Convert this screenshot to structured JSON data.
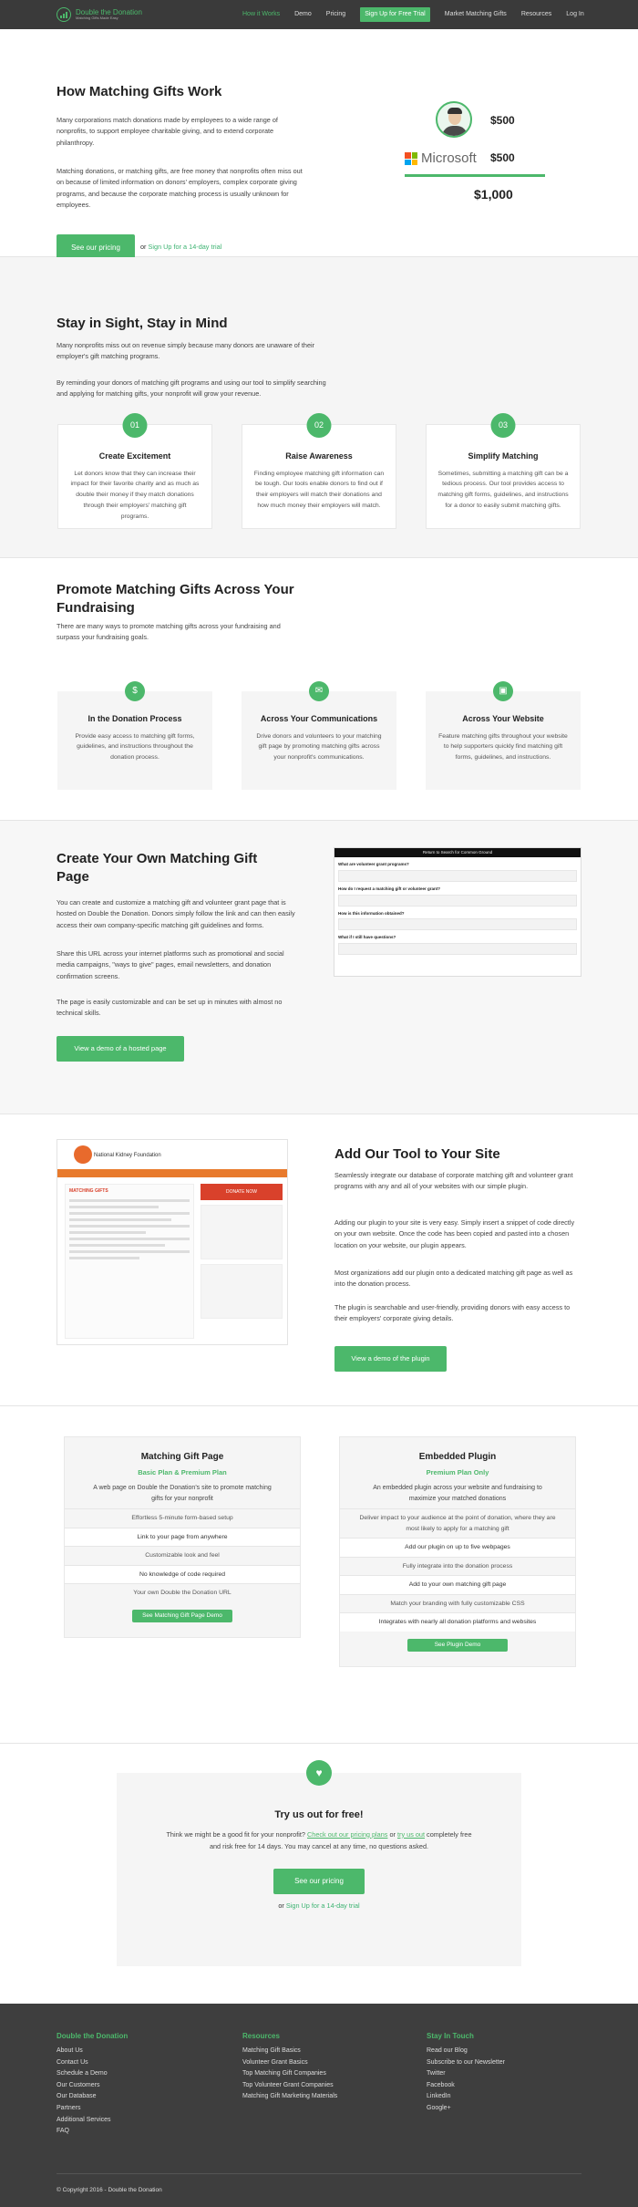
{
  "nav": {
    "logo_main": "Double the Donation",
    "logo_sub": "Matching Gifts Made Easy",
    "links": [
      "How it Works",
      "Demo",
      "Pricing"
    ],
    "cta": "Sign Up for Free Trial",
    "links2": [
      "Market Matching Gifts",
      "Resources",
      "Log In"
    ]
  },
  "hero": {
    "title": "How Matching Gifts Work",
    "p1": "Many corporations match donations made by employees to a wide range of nonprofits, to support employee charitable giving, and to extend corporate philanthropy.",
    "p2": "Matching donations, or matching gifts, are free money that nonprofits often miss out on because of limited information on donors' employers, complex corporate giving programs, and because the corporate matching process is usually unknown for employees.",
    "btn": "See our pricing",
    "or": "or",
    "trial": "Sign Up for a 14-day trial",
    "amt1": "$500",
    "company": "Microsoft",
    "amt2": "$500",
    "total": "$1,000"
  },
  "s2": {
    "title": "Stay in Sight, Stay in Mind",
    "p1": "Many nonprofits miss out on revenue simply because many donors are unaware of their employer's gift matching programs.",
    "p2": "By reminding your donors of matching gift programs and using our tool to simplify searching and applying for matching gifts, your nonprofit will grow your revenue.",
    "cards": [
      {
        "num": "01",
        "title": "Create Excitement",
        "desc": "Let donors know that they can increase their impact for their favorite charity and as much as double their money if they match donations through their employers' matching gift programs."
      },
      {
        "num": "02",
        "title": "Raise Awareness",
        "desc": "Finding employee matching gift information can be tough. Our tools enable donors to find out if their employers will match their donations and how much money their employers will match."
      },
      {
        "num": "03",
        "title": "Simplify Matching",
        "desc": "Sometimes, submitting a matching gift can be a tedious process. Our tool provides access to matching gift forms, guidelines, and instructions for a donor to easily submit matching gifts."
      }
    ]
  },
  "s3": {
    "title": "Promote Matching Gifts Across Your Fundraising",
    "p1": "There are many ways to promote matching gifts across your fundraising and surpass your fundraising goals.",
    "cards": [
      {
        "icon": "$",
        "title": "In the Donation Process",
        "desc": "Provide easy access to matching gift forms, guidelines, and instructions throughout the donation process."
      },
      {
        "icon": "✉",
        "title": "Across Your Communications",
        "desc": "Drive donors and volunteers to your matching gift page by promoting matching gifts across your nonprofit's communications."
      },
      {
        "icon": "▣",
        "title": "Across Your Website",
        "desc": "Feature matching gifts throughout your website to help supporters quickly find matching gift forms, guidelines, and instructions."
      }
    ]
  },
  "s4": {
    "title": "Create Your Own Matching Gift Page",
    "p1": "You can create and customize a matching gift and volunteer grant page that is hosted on Double the Donation. Donors simply follow the link and can then easily access their own company-specific matching gift guidelines and forms.",
    "p2": "Share this URL across your internet platforms such as promotional and social media campaigns, \"ways to give\" pages, email newsletters, and donation confirmation screens.",
    "p3": "The page is easily customizable and can be set up in minutes with almost no technical skills.",
    "btn": "View a demo of a hosted page",
    "shot_bar": "Return to Search for Common Ground",
    "shot_q": [
      "What are volunteer grant programs?",
      "How do I request a matching gift or volunteer grant?",
      "How is this information obtained?",
      "What if I still have questions?"
    ]
  },
  "s5": {
    "title": "Add Our Tool to Your Site",
    "p1": "Seamlessly integrate our database of corporate matching gift and volunteer grant programs with any and all of your websites with our simple plugin.",
    "p2": "Adding our plugin to your site is very easy. Simply insert a snippet of code directly on your own website. Once the code has been copied and pasted into a chosen location on your website, our plugin appears.",
    "p3": "Most organizations add our plugin onto a dedicated matching gift page as well as into the donation process.",
    "p4": "The plugin is searchable and user-friendly, providing donors with easy access to their employers' corporate giving details.",
    "btn": "View a demo of the plugin",
    "shot_org": "National Kidney Foundation",
    "shot_donate": "DONATE NOW",
    "shot_heading": "MATCHING GIFTS"
  },
  "plans": [
    {
      "title": "Matching Gift Page",
      "sub": "Basic Plan & Premium Plan",
      "desc": "A web page on Double the Donation's site to promote matching gifts for your nonprofit",
      "features": [
        "Effortless 5-minute form-based setup",
        "Link to your page from anywhere",
        "Customizable look and feel",
        "No knowledge of code required",
        "Your own Double the Donation URL"
      ],
      "btn": "See Matching Gift Page Demo"
    },
    {
      "title": "Embedded Plugin",
      "sub": "Premium Plan Only",
      "desc": "An embedded plugin across your website and fundraising to maximize your matched donations",
      "features": [
        "Deliver impact to your audience at the point of donation, where they are most likely to apply for a matching gift",
        "Add our plugin on up to five webpages",
        "Fully integrate into the donation process",
        "Add to your own matching gift page",
        "Match your branding with fully customizable CSS",
        "Integrates with nearly all donation platforms and websites"
      ],
      "btn": "See Plugin Demo"
    }
  ],
  "trial": {
    "title": "Try us out for free!",
    "desc_a": "Think we might be a good fit for your nonprofit?",
    "link1": "Check out our pricing plans",
    "desc_or": "or",
    "link2": "try us out",
    "desc_b": "completely free and risk free for 14 days. You may cancel at any time, no questions asked.",
    "btn": "See our pricing",
    "or": "or",
    "trial": "Sign Up for a 14-day trial"
  },
  "footer": {
    "cols": [
      {
        "head": "Double the Donation",
        "links": [
          "About Us",
          "Contact Us",
          "Schedule a Demo",
          "Our Customers",
          "Our Database",
          "Partners",
          "Additional Services",
          "FAQ"
        ]
      },
      {
        "head": "Resources",
        "links": [
          "Matching Gift Basics",
          "Volunteer Grant Basics",
          "Top Matching Gift Companies",
          "Top Volunteer Grant Companies",
          "Matching Gift Marketing Materials"
        ]
      },
      {
        "head": "Stay In Touch",
        "links": [
          "Read our Blog",
          "Subscribe to our Newsletter",
          "Twitter",
          "Facebook",
          "LinkedIn",
          "Google+"
        ]
      }
    ],
    "copyright": "© Copyright 2016 - Double the Donation"
  },
  "colors": {
    "accent": "#4cb86b",
    "nav_bg": "#3a3a3a",
    "footer_bg": "#3e3e3e"
  }
}
